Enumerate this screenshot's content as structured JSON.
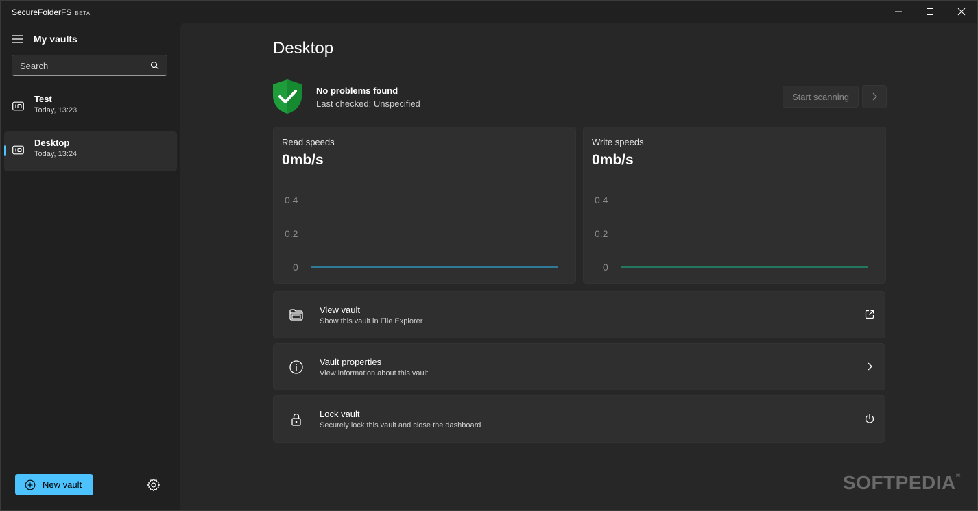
{
  "window": {
    "app_title": "SecureFolderFS",
    "badge": "BETA"
  },
  "sidebar": {
    "title": "My vaults",
    "search_label": "Search",
    "vaults": [
      {
        "name": "Test",
        "time": "Today, 13:23",
        "selected": false
      },
      {
        "name": "Desktop",
        "time": "Today, 13:24",
        "selected": true
      }
    ],
    "new_vault_label": "New vault"
  },
  "main": {
    "title": "Desktop",
    "health": {
      "title": "No problems found",
      "subtitle": "Last checked: Unspecified",
      "scan_label": "Start scanning"
    },
    "graphs": {
      "read": {
        "title": "Read speeds",
        "value": "0mb/s",
        "ticks": [
          "0.4",
          "0.2",
          "0"
        ],
        "line_color": "#2ea6d6"
      },
      "write": {
        "title": "Write speeds",
        "value": "0mb/s",
        "ticks": [
          "0.4",
          "0.2",
          "0"
        ],
        "line_color": "#1fa37c"
      }
    },
    "actions": [
      {
        "title": "View vault",
        "subtitle": "Show this vault in File Explorer",
        "icon": "folder-icon",
        "end_icon": "open-external-icon"
      },
      {
        "title": "Vault properties",
        "subtitle": "View information about this vault",
        "icon": "info-icon",
        "end_icon": "chevron-right-icon"
      },
      {
        "title": "Lock vault",
        "subtitle": "Securely lock this vault and close the dashboard",
        "icon": "lock-icon",
        "end_icon": "power-icon"
      }
    ]
  },
  "watermark": {
    "text": "SOFTPEDIA",
    "mark": "®"
  },
  "colors": {
    "accent": "#4cc2ff",
    "shield": "#1f9d3a",
    "background": "#202020",
    "card": "#2f2f2f"
  }
}
